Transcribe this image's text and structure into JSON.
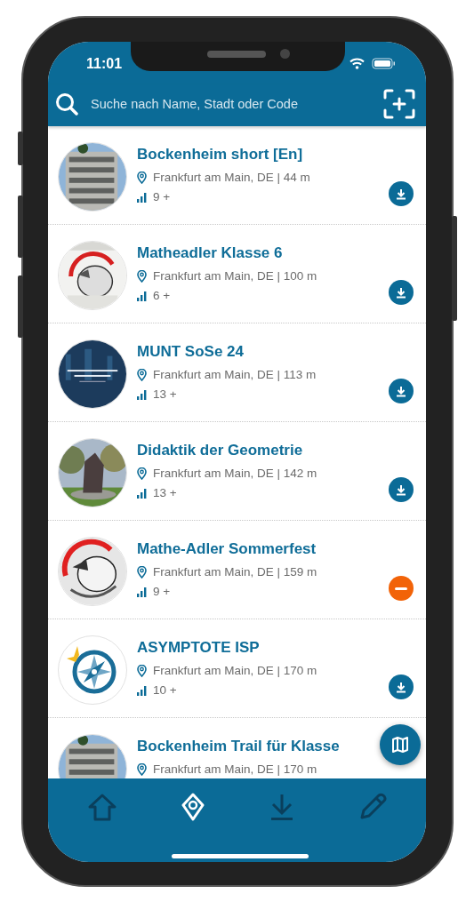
{
  "status_bar": {
    "time": "11:01"
  },
  "search": {
    "placeholder": "Suche nach Name, Stadt oder Code"
  },
  "trails": [
    {
      "title": "Bockenheim short [En]",
      "location": "Frankfurt am Main, DE | 44 m",
      "grade": "9 +",
      "action": {
        "kind": "download"
      }
    },
    {
      "title": "Matheadler Klasse 6",
      "location": "Frankfurt am Main, DE | 100 m",
      "grade": "6 +",
      "action": {
        "kind": "download"
      }
    },
    {
      "title": "MUNT SoSe 24",
      "location": "Frankfurt am Main, DE | 113 m",
      "grade": "13 +",
      "action": {
        "kind": "download"
      }
    },
    {
      "title": "Didaktik der Geometrie",
      "location": "Frankfurt am Main, DE | 142 m",
      "grade": "13 +",
      "action": {
        "kind": "download"
      }
    },
    {
      "title": "Mathe-Adler Sommerfest",
      "location": "Frankfurt am Main, DE | 159 m",
      "grade": "9 +",
      "action": {
        "kind": "remove"
      }
    },
    {
      "title": "ASYMPTOTE ISP",
      "location": "Frankfurt am Main, DE | 170 m",
      "grade": "10 +",
      "action": {
        "kind": "download"
      },
      "thumbnail": {
        "kind": "logo"
      }
    },
    {
      "title": "Bockenheim Trail für Klasse",
      "location": "Frankfurt am Main, DE | 170 m"
    }
  ],
  "nav": [
    {
      "kind": "home",
      "selected": false
    },
    {
      "kind": "places",
      "selected": true
    },
    {
      "kind": "downloads",
      "selected": false
    },
    {
      "kind": "edit",
      "selected": false
    }
  ]
}
